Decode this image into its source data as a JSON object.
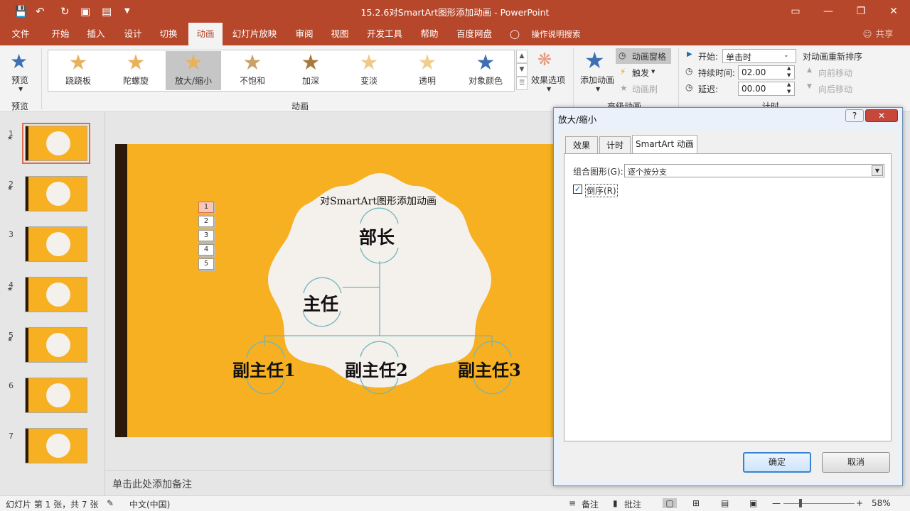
{
  "window": {
    "title": "15.2.6对SmartArt图形添加动画  -  PowerPoint",
    "quick_access": [
      "save-icon",
      "undo-icon",
      "redo-icon",
      "start-slideshow-icon",
      "present-icon",
      "customize-icon"
    ]
  },
  "menu": {
    "tabs": [
      "文件",
      "开始",
      "插入",
      "设计",
      "切换",
      "动画",
      "幻灯片放映",
      "审阅",
      "视图",
      "开发工具",
      "帮助",
      "百度网盘"
    ],
    "active": "动画",
    "tell_me": "操作说明搜索",
    "share": "共享"
  },
  "ribbon": {
    "preview_label": "预览",
    "preview_group": "预览",
    "animation_group": "动画",
    "advanced_group": "高级动画",
    "timing_group": "计时",
    "gallery": [
      {
        "label": "跷跷板",
        "color": "#e8b15b"
      },
      {
        "label": "陀螺旋",
        "color": "#e8b15b"
      },
      {
        "label": "放大/缩小",
        "color": "#e8b15b",
        "selected": true
      },
      {
        "label": "不饱和",
        "color": "#c9a26a"
      },
      {
        "label": "加深",
        "color": "#a87a3c"
      },
      {
        "label": "变淡",
        "color": "#f0c98a"
      },
      {
        "label": "透明",
        "color": "#efcf8e"
      },
      {
        "label": "对象颜色",
        "color": "#3d6fb5"
      }
    ],
    "effect_options": "效果选项",
    "add_animation": "添加动画",
    "animation_pane": "动画窗格",
    "trigger": "触发",
    "animation_painter": "动画刷",
    "start_label": "开始:",
    "start_value": "单击时",
    "duration_label": "持续时间:",
    "duration_value": "02.00",
    "delay_label": "延迟:",
    "delay_value": "00.00",
    "reorder_label": "对动画重新排序",
    "move_earlier": "向前移动",
    "move_later": "向后移动"
  },
  "slides": [
    {
      "num": "1",
      "has_anim": true
    },
    {
      "num": "2",
      "has_anim": true
    },
    {
      "num": "3",
      "has_anim": false
    },
    {
      "num": "4",
      "has_anim": true
    },
    {
      "num": "5",
      "has_anim": true
    },
    {
      "num": "6",
      "has_anim": false
    },
    {
      "num": "7",
      "has_anim": false
    }
  ],
  "slide": {
    "title": "对SmartArt图形添加动画",
    "boss": "部长",
    "assistant": "主任",
    "sub1": "副主任1",
    "sub2": "副主任2",
    "sub3": "副主任3",
    "anim_tags": [
      "1",
      "2",
      "3",
      "4",
      "5"
    ]
  },
  "notes_placeholder": "单击此处添加备注",
  "dialog": {
    "title": "放大/缩小",
    "help": "?",
    "close": "✕",
    "tabs": [
      "效果",
      "计时",
      "SmartArt 动画"
    ],
    "active_tab": "SmartArt 动画",
    "group_graphic_label": "组合图形(G):",
    "group_graphic_value": "逐个按分支",
    "reverse_label": "倒序(R)",
    "reverse_checked": true,
    "ok": "确定",
    "cancel": "取消"
  },
  "status": {
    "slide_info": "幻灯片 第 1 张，共 7 张",
    "language": "中文(中国)",
    "notes": "备注",
    "comments": "批注",
    "zoom": "58%"
  }
}
